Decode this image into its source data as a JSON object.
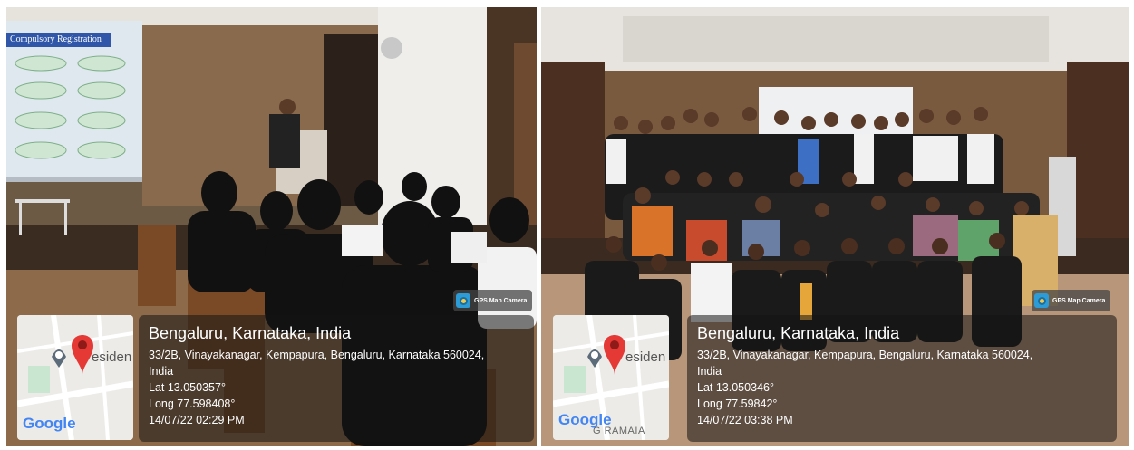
{
  "left_photo": {
    "slide_title": "Compulsory Registration",
    "badge": "GPS Map Camera",
    "location": {
      "city": "Bengaluru, Karnataka, India",
      "address_line1": "33/2B, Vinayakanagar, Kempapura, Bengaluru, Karnataka 560024,",
      "address_line2": "India",
      "lat": "Lat 13.050357°",
      "long": "Long 77.598408°",
      "datetime": "14/07/22 02:29 PM"
    },
    "map": {
      "label": "esiden",
      "brand": "Google",
      "extra_label": ""
    }
  },
  "right_photo": {
    "badge": "GPS Map Camera",
    "location": {
      "city": "Bengaluru, Karnataka, India",
      "address_line1": "33/2B, Vinayakanagar, Kempapura, Bengaluru, Karnataka 560024,",
      "address_line2": "India",
      "lat": "Lat 13.050346°",
      "long": "Long 77.59842°",
      "datetime": "14/07/22 03:38 PM"
    },
    "map": {
      "label": "esiden",
      "brand": "Google",
      "extra_label": "G RAMAIA"
    }
  },
  "colors": {
    "pin": "#e53935",
    "google_blue": "#4285f4",
    "google_red": "#ea4335",
    "google_yellow": "#fbbc05",
    "google_green": "#34a853"
  }
}
